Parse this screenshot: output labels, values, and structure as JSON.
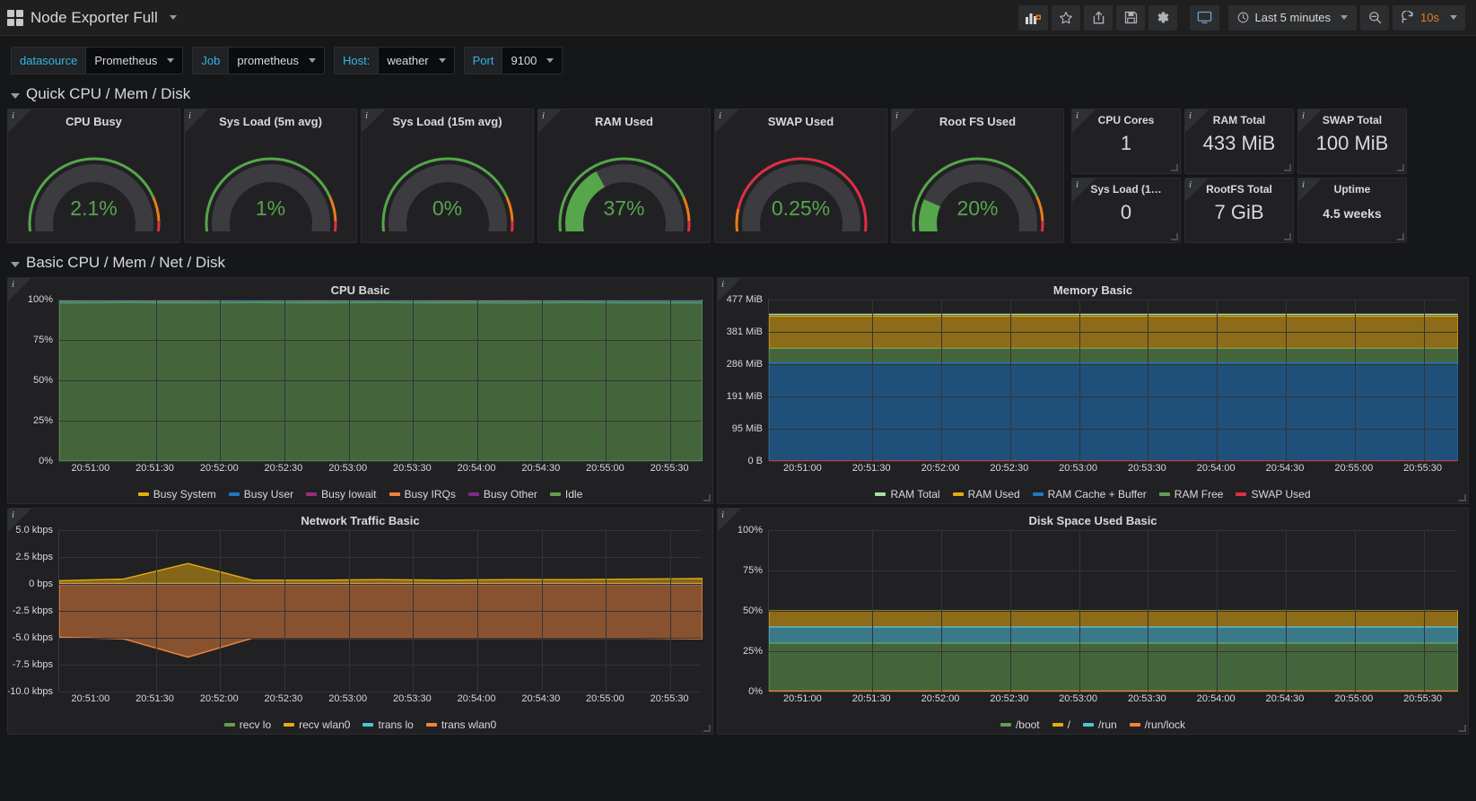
{
  "navbar": {
    "dashboard_title": "Node Exporter Full",
    "buttons": [
      {
        "name": "add-panel-button",
        "icon": "add-panel-icon",
        "label": ""
      },
      {
        "name": "star-button",
        "icon": "star-icon",
        "label": ""
      },
      {
        "name": "share-button",
        "icon": "share-icon",
        "label": ""
      },
      {
        "name": "save-button",
        "icon": "save-icon",
        "label": ""
      },
      {
        "name": "settings-button",
        "icon": "gear-icon",
        "label": ""
      },
      {
        "name": "tv-mode-button",
        "icon": "monitor-icon",
        "label": ""
      }
    ],
    "time_range": "Last 5 minutes",
    "zoom_out_label": "",
    "refresh_interval": "10s"
  },
  "variables": [
    {
      "label": "datasource",
      "value": "Prometheus"
    },
    {
      "label": "Job",
      "value": "prometheus"
    },
    {
      "label": "Host:",
      "value": "weather"
    },
    {
      "label": "Port",
      "value": "9100"
    }
  ],
  "rows": [
    {
      "title": "Quick CPU / Mem / Disk"
    },
    {
      "title": "Basic CPU / Mem / Net / Disk"
    }
  ],
  "gauges": [
    {
      "title": "CPU Busy",
      "value": "2.1%",
      "pct": 2.1,
      "color": "#56a64b",
      "thresholds": [
        {
          "at": 0,
          "color": "#56a64b"
        },
        {
          "at": 80,
          "color": "#eb7b18"
        },
        {
          "at": 90,
          "color": "#e02f44"
        }
      ]
    },
    {
      "title": "Sys Load (5m avg)",
      "value": "1%",
      "pct": 1,
      "color": "#56a64b",
      "thresholds": [
        {
          "at": 0,
          "color": "#56a64b"
        },
        {
          "at": 80,
          "color": "#eb7b18"
        },
        {
          "at": 90,
          "color": "#e02f44"
        }
      ]
    },
    {
      "title": "Sys Load (15m avg)",
      "value": "0%",
      "pct": 0.4,
      "color": "#56a64b",
      "thresholds": [
        {
          "at": 0,
          "color": "#56a64b"
        },
        {
          "at": 80,
          "color": "#eb7b18"
        },
        {
          "at": 90,
          "color": "#e02f44"
        }
      ]
    },
    {
      "title": "RAM Used",
      "value": "37%",
      "pct": 37,
      "color": "#56a64b",
      "thresholds": [
        {
          "at": 0,
          "color": "#56a64b"
        },
        {
          "at": 80,
          "color": "#eb7b18"
        },
        {
          "at": 90,
          "color": "#e02f44"
        }
      ]
    },
    {
      "title": "SWAP Used",
      "value": "0.25%",
      "pct": 1.2,
      "color": "#56a64b",
      "thresholds": [
        {
          "at": 0,
          "color": "#56a64b"
        },
        {
          "at": 5,
          "color": "#eb7b18"
        },
        {
          "at": 15,
          "color": "#e02f44"
        }
      ]
    },
    {
      "title": "Root FS Used",
      "value": "20%",
      "pct": 20,
      "color": "#56a64b",
      "thresholds": [
        {
          "at": 0,
          "color": "#56a64b"
        },
        {
          "at": 80,
          "color": "#eb7b18"
        },
        {
          "at": 90,
          "color": "#e02f44"
        }
      ]
    }
  ],
  "stats": [
    {
      "title": "CPU Cores",
      "value": "1",
      "small": false
    },
    {
      "title": "RAM Total",
      "value": "433 MiB",
      "small": false
    },
    {
      "title": "SWAP Total",
      "value": "100 MiB",
      "small": false
    },
    {
      "title": "Sys Load (1…",
      "value": "0",
      "small": false
    },
    {
      "title": "RootFS Total",
      "value": "7 GiB",
      "small": false
    },
    {
      "title": "Uptime",
      "value": "4.5 weeks",
      "small": true
    }
  ],
  "chart_data": [
    {
      "panel": "cpu-basic",
      "type": "area",
      "title": "CPU Basic",
      "stacked": true,
      "xlabel": "",
      "ylabel": "",
      "ylim": [
        0,
        100
      ],
      "yticks": [
        "0%",
        "25%",
        "50%",
        "75%",
        "100%"
      ],
      "ytick_values": [
        0,
        25,
        50,
        75,
        100
      ],
      "xticks": [
        "20:51:00",
        "20:51:30",
        "20:52:00",
        "20:52:30",
        "20:53:00",
        "20:53:30",
        "20:54:00",
        "20:54:30",
        "20:55:00",
        "20:55:30"
      ],
      "grid": true,
      "legend_position": "bottom",
      "series": [
        {
          "name": "Busy System",
          "color": "#e5ac0e",
          "values": [
            0.8,
            0.7,
            0.8,
            0.7,
            0.8,
            0.7,
            0.8,
            0.8,
            0.7,
            0.8,
            0.8
          ]
        },
        {
          "name": "Busy User",
          "color": "#1f78c1",
          "values": [
            0.9,
            0.8,
            0.8,
            0.9,
            0.8,
            0.9,
            0.8,
            0.9,
            0.8,
            0.9,
            0.9
          ]
        },
        {
          "name": "Busy Iowait",
          "color": "#962d82",
          "values": [
            0.1,
            0.1,
            0.1,
            0.1,
            0.1,
            0.1,
            0.1,
            0.1,
            0.1,
            0.1,
            0.1
          ]
        },
        {
          "name": "Busy IRQs",
          "color": "#ef843c",
          "values": [
            0.2,
            0.2,
            0.2,
            0.2,
            0.2,
            0.2,
            0.2,
            0.2,
            0.2,
            0.2,
            0.2
          ]
        },
        {
          "name": "Busy Other",
          "color": "#7b2b8e",
          "values": [
            0.1,
            0.1,
            0.1,
            0.1,
            0.1,
            0.1,
            0.1,
            0.1,
            0.1,
            0.1,
            0.1
          ]
        },
        {
          "name": "Idle",
          "color": "#629e51",
          "values": [
            97.9,
            98.1,
            98.0,
            98.1,
            98.0,
            98.1,
            98.0,
            97.9,
            98.1,
            98.0,
            98.0
          ]
        }
      ]
    },
    {
      "panel": "memory-basic",
      "type": "area",
      "title": "Memory Basic",
      "stacked": true,
      "xlabel": "",
      "ylabel": "",
      "ylim": [
        0,
        477
      ],
      "yticks": [
        "0 B",
        "95 MiB",
        "191 MiB",
        "286 MiB",
        "381 MiB",
        "477 MiB"
      ],
      "ytick_values": [
        0,
        95,
        191,
        286,
        381,
        477
      ],
      "xticks": [
        "20:51:00",
        "20:51:30",
        "20:52:00",
        "20:52:30",
        "20:53:00",
        "20:53:30",
        "20:54:00",
        "20:54:30",
        "20:55:00",
        "20:55:30"
      ],
      "grid": true,
      "legend_position": "bottom",
      "series": [
        {
          "name": "RAM Total",
          "color": "#a9e2a0",
          "values": [
            433,
            433,
            433,
            433,
            433,
            433,
            433,
            433,
            433,
            433,
            433
          ]
        },
        {
          "name": "RAM Used",
          "color": "#e5ac0e",
          "values": [
            95,
            95,
            95,
            95,
            95,
            95,
            95,
            95,
            95,
            95,
            95
          ]
        },
        {
          "name": "RAM Cache + Buffer",
          "color": "#1f78c1",
          "values": [
            290,
            290,
            290,
            290,
            290,
            290,
            290,
            290,
            290,
            290,
            290
          ]
        },
        {
          "name": "RAM Free",
          "color": "#629e51",
          "values": [
            43,
            43,
            43,
            43,
            43,
            43,
            43,
            43,
            43,
            43,
            43
          ]
        },
        {
          "name": "SWAP Used",
          "color": "#e02f44",
          "values": [
            0.25,
            0.25,
            0.25,
            0.25,
            0.25,
            0.25,
            0.25,
            0.25,
            0.25,
            0.25,
            0.25
          ]
        }
      ]
    },
    {
      "panel": "network-traffic-basic",
      "type": "area",
      "title": "Network Traffic Basic",
      "stacked": false,
      "xlabel": "",
      "ylabel": "",
      "ylim": [
        -10.0,
        5.0
      ],
      "yticks": [
        "-10.0 kbps",
        "-7.5 kbps",
        "-5.0 kbps",
        "-2.5 kbps",
        "0 bps",
        "2.5 kbps",
        "5.0 kbps"
      ],
      "ytick_values": [
        -10.0,
        -7.5,
        -5.0,
        -2.5,
        0,
        2.5,
        5.0
      ],
      "xticks": [
        "20:51:00",
        "20:51:30",
        "20:52:00",
        "20:52:30",
        "20:53:00",
        "20:53:30",
        "20:54:00",
        "20:54:30",
        "20:55:00",
        "20:55:30"
      ],
      "grid": true,
      "legend_position": "bottom",
      "series": [
        {
          "name": "recv lo",
          "color": "#629e51",
          "values": [
            0.05,
            0.05,
            0.05,
            0.05,
            0.05,
            0.05,
            0.05,
            0.05,
            0.05,
            0.05,
            0.05
          ]
        },
        {
          "name": "recv wlan0",
          "color": "#e5ac0e",
          "values": [
            0.3,
            0.45,
            1.9,
            0.35,
            0.35,
            0.4,
            0.35,
            0.4,
            0.4,
            0.45,
            0.5
          ]
        },
        {
          "name": "trans lo",
          "color": "#50c3dc",
          "values": [
            -0.05,
            -0.05,
            -0.05,
            -0.05,
            -0.05,
            -0.05,
            -0.05,
            -0.05,
            -0.05,
            -0.05,
            -0.05
          ]
        },
        {
          "name": "trans wlan0",
          "color": "#ef843c",
          "values": [
            -4.95,
            -5.1,
            -6.8,
            -5.05,
            -5.05,
            -5.05,
            -5.05,
            -5.05,
            -5.05,
            -5.05,
            -5.1
          ]
        }
      ]
    },
    {
      "panel": "disk-space-used-basic",
      "type": "area",
      "title": "Disk Space Used Basic",
      "stacked": true,
      "xlabel": "",
      "ylabel": "",
      "ylim": [
        0,
        100
      ],
      "yticks": [
        "0%",
        "25%",
        "50%",
        "75%",
        "100%"
      ],
      "ytick_values": [
        0,
        25,
        50,
        75,
        100
      ],
      "xticks": [
        "20:51:00",
        "20:51:30",
        "20:52:00",
        "20:52:30",
        "20:53:00",
        "20:53:30",
        "20:54:00",
        "20:54:30",
        "20:55:00",
        "20:55:30"
      ],
      "grid": true,
      "legend_position": "bottom",
      "series": [
        {
          "name": "/boot",
          "color": "#629e51",
          "values": [
            30,
            30,
            30,
            30,
            30,
            30,
            30,
            30,
            30,
            30,
            30
          ]
        },
        {
          "name": "/",
          "color": "#e5ac0e",
          "values": [
            10,
            10,
            10,
            10,
            10,
            10,
            10,
            10,
            10,
            10,
            10
          ]
        },
        {
          "name": "/run",
          "color": "#50c3dc",
          "values": [
            10,
            10,
            10,
            10,
            10,
            10,
            10,
            10,
            10,
            10,
            10
          ]
        },
        {
          "name": "/run/lock",
          "color": "#ef843c",
          "values": [
            0.2,
            0.2,
            0.2,
            0.2,
            0.2,
            0.2,
            0.2,
            0.2,
            0.2,
            0.2,
            0.2
          ]
        }
      ]
    }
  ]
}
